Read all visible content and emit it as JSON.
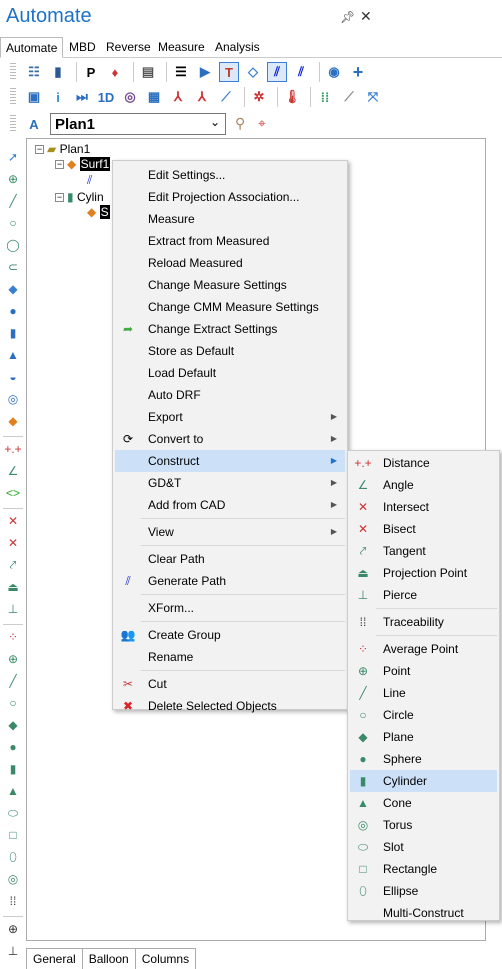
{
  "window": {
    "title": "Automate",
    "pin_icon": "pin-icon",
    "close_icon": "close-icon"
  },
  "tabs": [
    {
      "label": "Automate",
      "active": true
    },
    {
      "label": "MBD"
    },
    {
      "label": "Reverse"
    },
    {
      "label": "Measure"
    },
    {
      "label": "Analysis"
    }
  ],
  "toolbar": {
    "plan_select": "Plan1",
    "p_label": "P",
    "oned_label": "1D"
  },
  "tree": {
    "root": "Plan1",
    "surf": "Surf1",
    "cyl": "Cylin",
    "sub": "S"
  },
  "bottom_tabs": [
    "General",
    "Balloon",
    "Columns"
  ],
  "context_menu": [
    {
      "label": "Edit Settings..."
    },
    {
      "label": "Edit Projection Association..."
    },
    {
      "label": "Measure"
    },
    {
      "label": "Extract from Measured"
    },
    {
      "label": "Reload Measured"
    },
    {
      "label": "Change Measure Settings"
    },
    {
      "label": "Change CMM Measure Settings"
    },
    {
      "label": "Change Extract Settings",
      "icon": "green-arrow-icon"
    },
    {
      "label": "Store as Default"
    },
    {
      "label": "Load Default"
    },
    {
      "label": "Auto DRF"
    },
    {
      "label": "Export",
      "submenu": true
    },
    {
      "label": "Convert to",
      "icon": "convert-icon",
      "submenu": true
    },
    {
      "label": "Construct",
      "submenu": true,
      "highlighted": true
    },
    {
      "label": "GD&T",
      "submenu": true
    },
    {
      "label": "Add from CAD",
      "submenu": true
    },
    {
      "sep": true
    },
    {
      "label": "View",
      "submenu": true
    },
    {
      "sep": true
    },
    {
      "label": "Clear Path"
    },
    {
      "label": "Generate Path",
      "icon": "path-icon"
    },
    {
      "sep": true
    },
    {
      "label": "XForm..."
    },
    {
      "sep": true
    },
    {
      "label": "Create Group",
      "icon": "group-icon"
    },
    {
      "label": "Rename"
    },
    {
      "sep": true
    },
    {
      "label": "Cut",
      "icon": "scissors-icon"
    },
    {
      "label": "Delete Selected Objects",
      "icon": "delete-icon"
    }
  ],
  "construct_submenu": [
    {
      "label": "Distance",
      "icon": "distance-icon"
    },
    {
      "label": "Angle",
      "icon": "angle-icon"
    },
    {
      "label": "Intersect",
      "icon": "intersect-icon"
    },
    {
      "label": "Bisect",
      "icon": "bisect-icon"
    },
    {
      "label": "Tangent",
      "icon": "tangent-icon"
    },
    {
      "label": "Projection Point",
      "icon": "projection-point-icon"
    },
    {
      "label": "Pierce",
      "icon": "pierce-icon"
    },
    {
      "sep": true
    },
    {
      "label": "Traceability",
      "icon": "traceability-icon"
    },
    {
      "sep": true
    },
    {
      "label": "Average Point",
      "icon": "average-point-icon"
    },
    {
      "label": "Point",
      "icon": "point-icon"
    },
    {
      "label": "Line",
      "icon": "line-icon"
    },
    {
      "label": "Circle",
      "icon": "circle-icon"
    },
    {
      "label": "Plane",
      "icon": "plane-icon"
    },
    {
      "label": "Sphere",
      "icon": "sphere-icon"
    },
    {
      "label": "Cylinder",
      "icon": "cylinder-icon",
      "highlighted": true
    },
    {
      "label": "Cone",
      "icon": "cone-icon"
    },
    {
      "label": "Torus",
      "icon": "torus-icon"
    },
    {
      "label": "Slot",
      "icon": "slot-icon"
    },
    {
      "label": "Rectangle",
      "icon": "rectangle-icon"
    },
    {
      "label": "Ellipse",
      "icon": "ellipse-icon"
    },
    {
      "label": "Multi-Construct"
    }
  ],
  "colors": {
    "accent": "#1e73c8",
    "highlight": "#cce0f7",
    "menu_bg": "#f2f2f2"
  }
}
